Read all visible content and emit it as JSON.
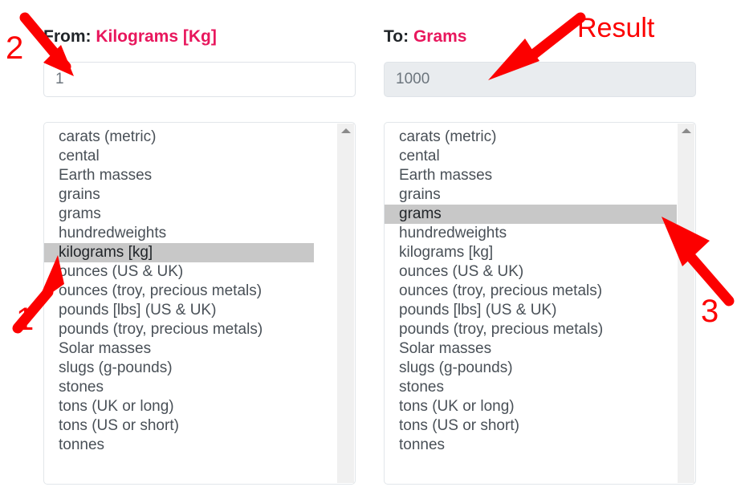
{
  "converter": {
    "source": {
      "label_prefix": "From:",
      "unit_name": "Kilograms [Kg]",
      "input_value": "1",
      "input_placeholder": "",
      "selected_option": "kilograms [kg]",
      "options": [
        "carats (metric)",
        "cental",
        "Earth masses",
        "grains",
        "grams",
        "hundredweights",
        "kilograms [kg]",
        "ounces (US & UK)",
        "ounces (troy, precious metals)",
        "pounds [lbs] (US & UK)",
        "pounds (troy, precious metals)",
        "Solar masses",
        "slugs (g-pounds)",
        "stones",
        "tons (UK or long)",
        "tons (US or short)",
        "tonnes"
      ]
    },
    "target": {
      "label_prefix": "To:",
      "unit_name": "Grams",
      "input_value": "1000",
      "input_placeholder": "",
      "selected_option": "grams",
      "options": [
        "carats (metric)",
        "cental",
        "Earth masses",
        "grains",
        "grams",
        "hundredweights",
        "kilograms [kg]",
        "ounces (US & UK)",
        "ounces (troy, precious metals)",
        "pounds [lbs] (US & UK)",
        "pounds (troy, precious metals)",
        "Solar masses",
        "slugs (g-pounds)",
        "stones",
        "tons (UK or long)",
        "tons (US or short)",
        "tonnes"
      ]
    }
  },
  "annotations": {
    "step_one": "1",
    "step_two": "2",
    "step_three": "3",
    "result_caption": "Result"
  },
  "colors": {
    "accent_pink": "#e8175d",
    "annotation_red": "#fc0000",
    "selection_gray": "#c8c8c8",
    "readonly_bg": "#e9ecef"
  },
  "icons": {
    "scroll_up": "scroll-up-arrow-icon"
  }
}
